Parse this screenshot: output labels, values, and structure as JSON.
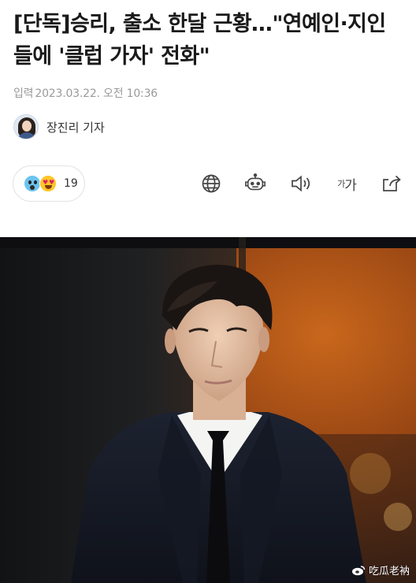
{
  "article": {
    "headline": "[단독]승리, 출소 한달 근황…\"연예인·지인들에 '클럽 가자' 전화\"",
    "date_label": "입력",
    "date_value": "2023.03.22. 오전 10:36",
    "reporter_name": "장진리 기자"
  },
  "reactions": {
    "count": "19",
    "emoji_1": "surprised-emoji",
    "emoji_2": "heart-eyes-emoji"
  },
  "toolbar": {
    "font_size_small": "가",
    "font_size_large": "가",
    "icons": [
      "globe-icon",
      "robot-icon",
      "speaker-icon",
      "font-size-icon",
      "share-icon"
    ]
  },
  "photo": {
    "watermark": "吃瓜老衲"
  },
  "colors": {
    "headline": "#1a1a1a",
    "meta": "#9a9a9a",
    "photo_bg_warm": "#b35a16",
    "photo_bg_dark": "#1c1a1c"
  }
}
